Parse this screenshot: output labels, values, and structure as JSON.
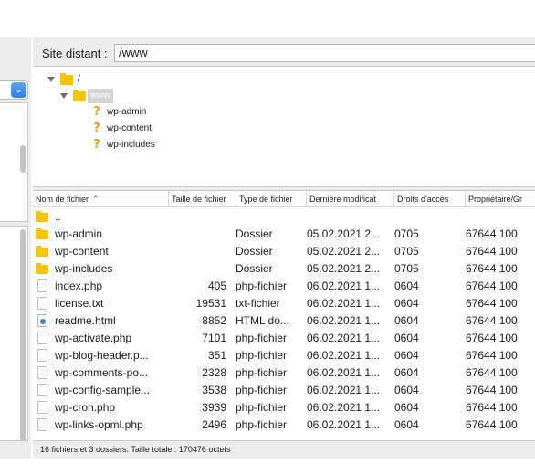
{
  "remote": {
    "label": "Site distant :",
    "path": "/www"
  },
  "tree": [
    {
      "label": "/",
      "expanded": true,
      "icon": "folder-icon"
    },
    {
      "label": "www",
      "expanded": true,
      "selected": true,
      "icon": "folder-icon"
    },
    {
      "label": "wp-admin",
      "icon": "question-icon"
    },
    {
      "label": "wp-content",
      "icon": "question-icon"
    },
    {
      "label": "wp-includes",
      "icon": "question-icon"
    }
  ],
  "list": {
    "columns": [
      "Nom de fichier",
      "Taille de fichier",
      "Type de fichier",
      "Dernière modificat",
      "Droits d'accès",
      "Propriétaire/Gr"
    ],
    "sort_icon": "sort-ascending-icon",
    "rows": [
      {
        "icon": "folder",
        "name": "..",
        "size": "",
        "type": "",
        "date": "",
        "perm": "",
        "owner": ""
      },
      {
        "icon": "folder",
        "name": "wp-admin",
        "size": "",
        "type": "Dossier",
        "date": "05.02.2021 2...",
        "perm": "0705",
        "owner": "67644 100"
      },
      {
        "icon": "folder",
        "name": "wp-content",
        "size": "",
        "type": "Dossier",
        "date": "05.02.2021 2...",
        "perm": "0705",
        "owner": "67644 100"
      },
      {
        "icon": "folder",
        "name": "wp-includes",
        "size": "",
        "type": "Dossier",
        "date": "05.02.2021 2...",
        "perm": "0705",
        "owner": "67644 100"
      },
      {
        "icon": "file",
        "name": "index.php",
        "size": "405",
        "type": "php-fichier",
        "date": "06.02.2021 1...",
        "perm": "0604",
        "owner": "67644 100"
      },
      {
        "icon": "file",
        "name": "license.txt",
        "size": "19531",
        "type": "txt-fichier",
        "date": "06.02.2021 1...",
        "perm": "0604",
        "owner": "67644 100"
      },
      {
        "icon": "html",
        "name": "readme.html",
        "size": "8852",
        "type": "HTML do...",
        "date": "06.02.2021 1...",
        "perm": "0604",
        "owner": "67644 100"
      },
      {
        "icon": "file",
        "name": "wp-activate.php",
        "size": "7101",
        "type": "php-fichier",
        "date": "06.02.2021 1...",
        "perm": "0604",
        "owner": "67644 100"
      },
      {
        "icon": "file",
        "name": "wp-blog-header.p...",
        "size": "351",
        "type": "php-fichier",
        "date": "06.02.2021 1...",
        "perm": "0604",
        "owner": "67644 100"
      },
      {
        "icon": "file",
        "name": "wp-comments-po...",
        "size": "2328",
        "type": "php-fichier",
        "date": "06.02.2021 1...",
        "perm": "0604",
        "owner": "67644 100"
      },
      {
        "icon": "file",
        "name": "wp-config-sample...",
        "size": "3538",
        "type": "php-fichier",
        "date": "06.02.2021 1...",
        "perm": "0604",
        "owner": "67644 100"
      },
      {
        "icon": "file",
        "name": "wp-cron.php",
        "size": "3939",
        "type": "php-fichier",
        "date": "06.02.2021 1...",
        "perm": "0604",
        "owner": "67644 100"
      },
      {
        "icon": "file",
        "name": "wp-links-opml.php",
        "size": "2496",
        "type": "php-fichier",
        "date": "06.02.2021 1...",
        "perm": "0604",
        "owner": "67644 100"
      }
    ]
  },
  "status": "16 fichiers et 3 dossiers. Taille totale : 170476 octets",
  "colors": {
    "folder": "#f6c500",
    "question": "#f0a000",
    "accent": "#2a7ef0"
  }
}
